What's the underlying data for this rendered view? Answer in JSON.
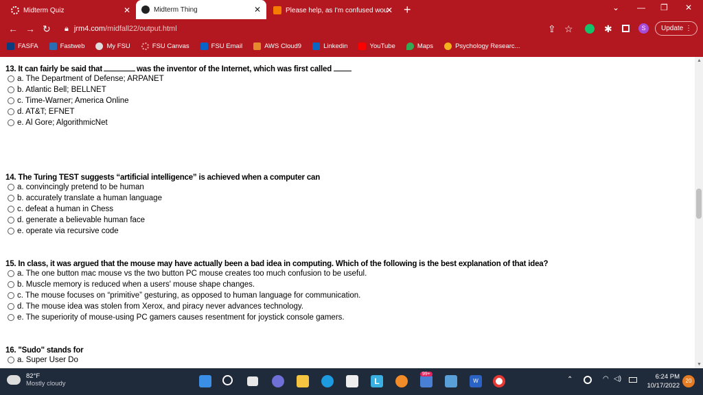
{
  "browser": {
    "tabs": [
      {
        "title": "Midterm Quiz",
        "active": false
      },
      {
        "title": "Midterm Thing",
        "active": true
      },
      {
        "title": "Please help, as I'm confused wou",
        "active": false
      }
    ],
    "url_host": "jrm4.com",
    "url_path": "/midfall22/output.html",
    "update_label": "Update",
    "profile_letter": "S",
    "bookmarks": [
      "FASFA",
      "Fastweb",
      "My FSU",
      "FSU Canvas",
      "FSU Email",
      "AWS Cloud9",
      "Linkedin",
      "YouTube",
      "Maps",
      "Psychology Researc..."
    ]
  },
  "questions": [
    {
      "title_parts": [
        "13. It can fairly be said that",
        "was the inventor of the Internet, which was first called"
      ],
      "options": [
        "a. The Department of Defense; ARPANET",
        "b. Atlantic Bell; BELLNET",
        "c. Time-Warner; America Online",
        "d. AT&T; EFNET",
        "e. Al Gore; AlgorithmicNet"
      ]
    },
    {
      "title": "14. The Turing TEST suggests “artificial intelligence” is achieved when a computer can",
      "options": [
        "a. convincingly pretend to be human",
        "b. accurately translate a human language",
        "c. defeat a human in Chess",
        "d. generate a believable human face",
        "e. operate via recursive code"
      ]
    },
    {
      "title": "15. In class, it was argued that the mouse may have actually been a bad idea in computing. Which of the following is the best explanation of that idea?",
      "options": [
        "a. The one button mac mouse vs the two button PC mouse creates too much confusion to be useful.",
        "b. Muscle memory is reduced when a users' mouse shape changes.",
        "c. The mouse focuses on “primitive” gesturing, as opposed to human language for communication.",
        "d. The mouse idea was stolen from Xerox, and piracy never advances technology.",
        "e. The superiority of mouse-using PC gamers causes resentment for joystick console gamers."
      ]
    },
    {
      "title": "16. \"Sudo\" stands for",
      "options": [
        "a. Super User Do"
      ]
    }
  ],
  "taskbar": {
    "temp": "82°F",
    "weather": "Mostly cloudy",
    "time": "6:24 PM",
    "date": "10/17/2022",
    "notif_count": "20",
    "badge": "99+"
  },
  "colors": {
    "chrome": "#b3171f",
    "taskbar": "#1f2a3a"
  }
}
